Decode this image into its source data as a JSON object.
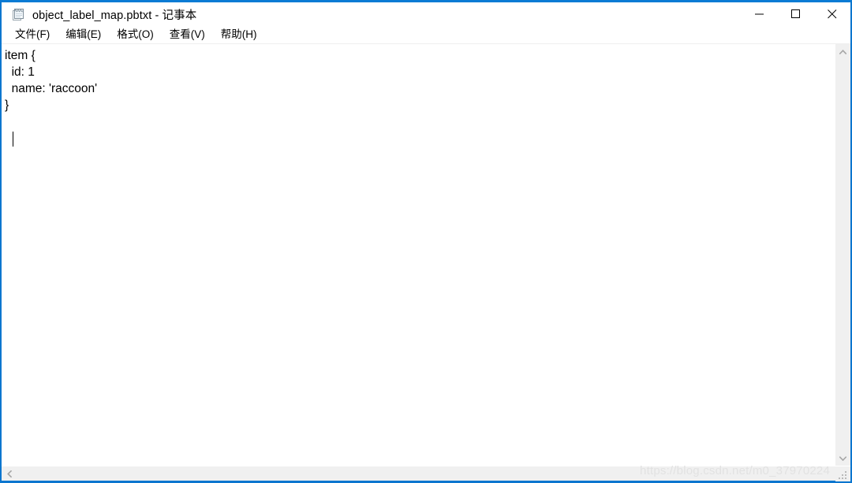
{
  "window": {
    "title": "object_label_map.pbtxt - 记事本",
    "icon": "notepad-icon",
    "controls": {
      "minimize": "minimize-icon",
      "maximize": "maximize-icon",
      "close": "close-icon"
    },
    "accent_color": "#0a76cf",
    "titlebar_background": "#ffffff"
  },
  "menu": {
    "items": [
      {
        "label": "文件(F)"
      },
      {
        "label": "编辑(E)"
      },
      {
        "label": "格式(O)"
      },
      {
        "label": "查看(V)"
      },
      {
        "label": "帮助(H)"
      }
    ]
  },
  "editor": {
    "lines": [
      "item {",
      "  id: 1",
      "  name: 'raccoon'",
      "}"
    ],
    "caret_line": 4,
    "caret_column": 2,
    "background": "#ffffff",
    "foreground": "#000000"
  },
  "scrollbars": {
    "vertical": {
      "up_arrow": "chevron-up-icon",
      "down_arrow": "chevron-down-icon",
      "track_color": "#f0f0f0",
      "thumb_visible": false
    },
    "horizontal": {
      "left_arrow": "chevron-left-icon",
      "track_color": "#f0f0f0",
      "thumb_visible": false
    },
    "resize_grip": "resize-grip-icon"
  },
  "watermark": {
    "text": "https://blog.csdn.net/m0_37970224",
    "color": "#e2e2e2"
  }
}
